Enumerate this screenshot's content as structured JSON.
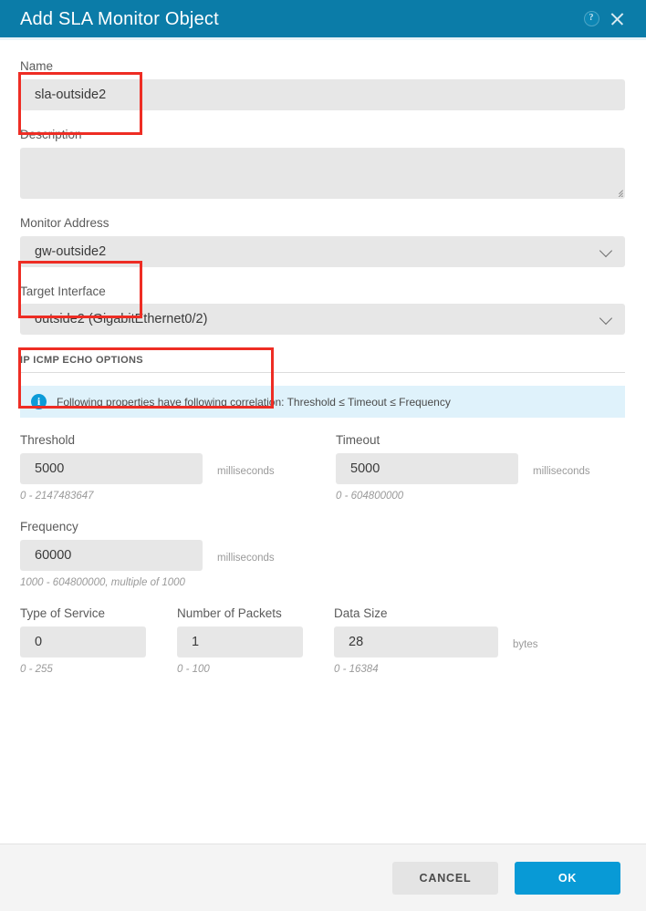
{
  "dialog": {
    "title": "Add SLA Monitor Object",
    "help_icon": "help-circle-icon",
    "close_icon": "close-icon"
  },
  "form": {
    "name": {
      "label": "Name",
      "value": "sla-outside2",
      "placeholder": ""
    },
    "description": {
      "label": "Description",
      "value": "",
      "placeholder": ""
    },
    "monitor_address": {
      "label": "Monitor Address",
      "value": "gw-outside2"
    },
    "target_interface": {
      "label": "Target Interface",
      "value": "outside2 (GigabitEthernet0/2)"
    }
  },
  "section": {
    "title": "IP ICMP ECHO OPTIONS",
    "info_icon": "info-icon",
    "info_text": "Following properties have following correlation: Threshold ≤ Timeout ≤ Frequency"
  },
  "fields": {
    "threshold": {
      "label": "Threshold",
      "value": "5000",
      "unit": "milliseconds",
      "hint": "0 - 2147483647"
    },
    "timeout": {
      "label": "Timeout",
      "value": "5000",
      "unit": "milliseconds",
      "hint": "0 - 604800000"
    },
    "frequency": {
      "label": "Frequency",
      "value": "60000",
      "unit": "milliseconds",
      "hint": "1000 - 604800000, multiple of 1000"
    },
    "type_of_service": {
      "label": "Type of Service",
      "value": "0",
      "unit": "",
      "hint": "0 - 255"
    },
    "number_of_packets": {
      "label": "Number of Packets",
      "value": "1",
      "unit": "",
      "hint": "0 - 100"
    },
    "data_size": {
      "label": "Data Size",
      "value": "28",
      "unit": "bytes",
      "hint": "0 - 16384"
    }
  },
  "footer": {
    "cancel_label": "CANCEL",
    "ok_label": "OK"
  },
  "colors": {
    "header_bg": "#0b7ca8",
    "primary_button": "#089ad6",
    "info_banner_bg": "#dff2fb",
    "annotation": "#ee2d24",
    "input_bg": "#e7e7e7"
  }
}
